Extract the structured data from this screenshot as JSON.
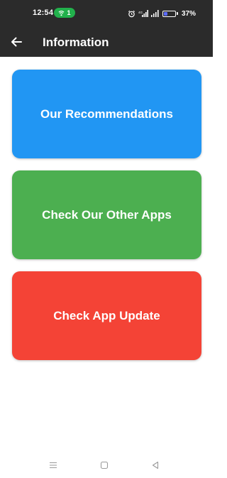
{
  "status_bar": {
    "time": "12:54",
    "hotspot_count": "1",
    "battery_percent": "37%",
    "battery_level": 0.37
  },
  "app_bar": {
    "title": "Information",
    "back_icon": "arrow-left-icon"
  },
  "cards": [
    {
      "label": "Our Recommendations",
      "color": "#2196f3"
    },
    {
      "label": "Check Our Other Apps",
      "color": "#4caf50"
    },
    {
      "label": "Check App Update",
      "color": "#f44336"
    }
  ],
  "nav_bar": {
    "icons": [
      "menu-icon",
      "home-icon",
      "back-triangle-icon"
    ]
  },
  "colors": {
    "app_bar": "#2b2b2b",
    "background": "#ffffff",
    "hotspot": "#22b14c"
  }
}
